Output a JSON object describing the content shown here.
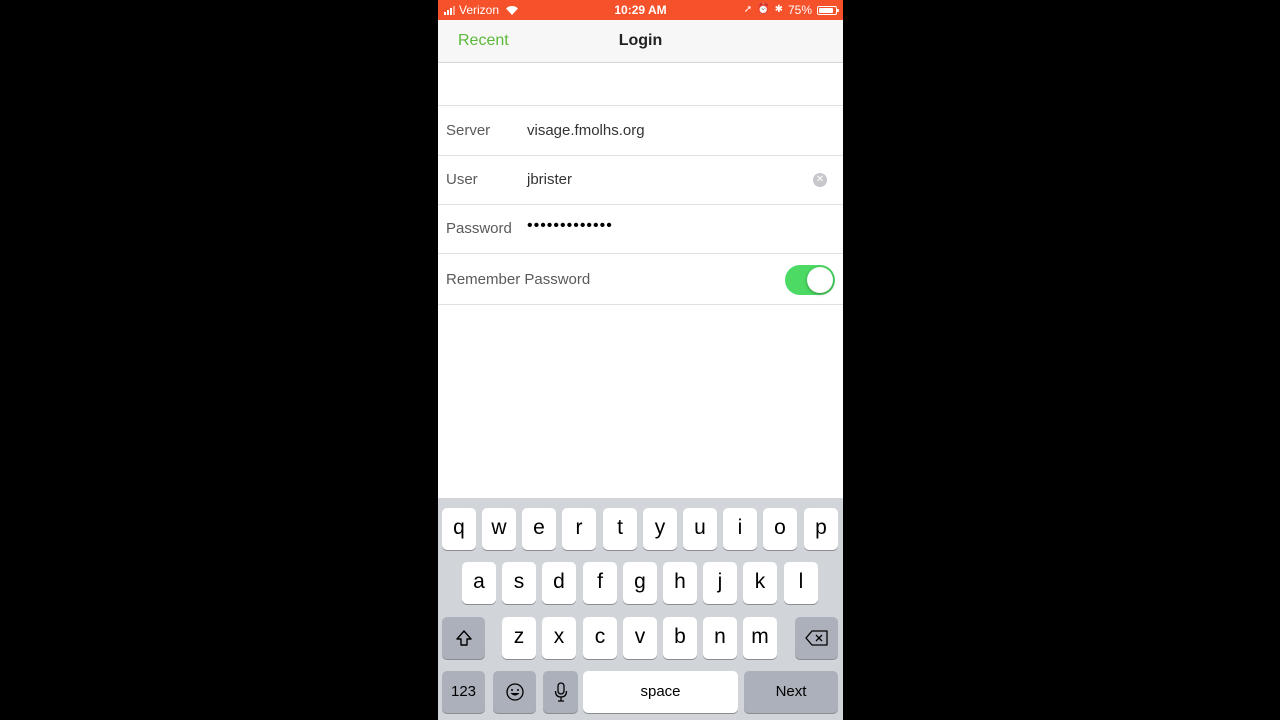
{
  "status_bar": {
    "carrier": "Verizon",
    "time": "10:29 AM",
    "battery": "75%",
    "icons": [
      "signal-icon",
      "wifi-icon",
      "location-icon",
      "alarm-icon",
      "bluetooth-icon",
      "battery-icon"
    ]
  },
  "nav": {
    "back_label": "Recent",
    "title": "Login",
    "accent_color": "#5cb83a"
  },
  "form": {
    "server": {
      "label": "Server",
      "value": "visage.fmolhs.org"
    },
    "user": {
      "label": "User",
      "value": "jbrister"
    },
    "password": {
      "label": "Password",
      "masked": "•••••••••••••"
    },
    "remember": {
      "label": "Remember Password",
      "on": true
    }
  },
  "keyboard": {
    "row1": [
      "q",
      "w",
      "e",
      "r",
      "t",
      "y",
      "u",
      "i",
      "o",
      "p"
    ],
    "row2": [
      "a",
      "s",
      "d",
      "f",
      "g",
      "h",
      "j",
      "k",
      "l"
    ],
    "row3": [
      "z",
      "x",
      "c",
      "v",
      "b",
      "n",
      "m"
    ],
    "numbers_label": "123",
    "space_label": "space",
    "next_label": "Next"
  },
  "colors": {
    "status_bar": "#f5512a",
    "toggle_on": "#4cd964"
  }
}
